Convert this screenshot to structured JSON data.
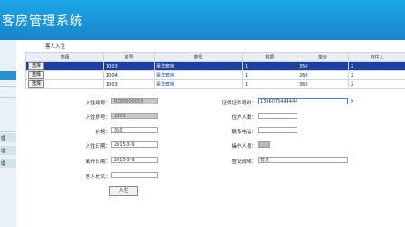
{
  "app": {
    "title": "客房管理系统"
  },
  "breadcrumb": "客人入住",
  "table": {
    "headers": [
      "选择",
      "房号",
      "类型",
      "楼层",
      "单价",
      "可住人"
    ],
    "rows": [
      {
        "select": "选择",
        "room": "1003",
        "type": "豪华套房",
        "floor": "1",
        "price": "350",
        "capacity": "2",
        "selected": true
      },
      {
        "select": "选择",
        "room": "1004",
        "type": "豪华套房",
        "floor": "1",
        "price": "260",
        "capacity": "2",
        "selected": false
      },
      {
        "select": "选择",
        "room": "1003",
        "type": "豪华套房",
        "floor": "1",
        "price": "360",
        "capacity": "2",
        "selected": false
      }
    ]
  },
  "form": {
    "checkin_no_label": "入住编号：",
    "checkin_no_value": "RZ00000003",
    "room_no_label": "入住房号：",
    "room_no_value": "1003",
    "price_label": "价格：",
    "price_value": "350",
    "checkin_date_label": "入住日期：",
    "checkin_date_value": "2015-3-9",
    "checkout_date_label": "离开日期：",
    "checkout_date_value": "2015-3-9",
    "guest_name_label": "客人姓名：",
    "guest_name_value": "",
    "id_no_label": "证件证件号码：",
    "id_no_value": "1366075444444",
    "clear_symbol": "×",
    "checkin_count_label": "住户人数：",
    "checkin_count_value": "",
    "phone_label": "联系电话：",
    "phone_value": "",
    "operator_label": "操作人员：",
    "remark_label": "登记说明：",
    "remark_value": "暂无",
    "submit": "入住"
  },
  "sidebar": {
    "items": [
      "",
      "",
      "",
      "理",
      "理",
      "理"
    ]
  }
}
